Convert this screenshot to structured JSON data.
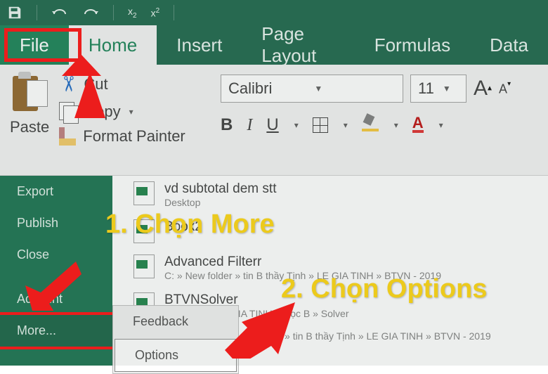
{
  "titlebar": {
    "sub_label": "x",
    "sup_label": "x"
  },
  "tabs": {
    "file": "File",
    "home": "Home",
    "insert": "Insert",
    "page_layout": "Page Layout",
    "formulas": "Formulas",
    "data": "Data"
  },
  "ribbon": {
    "paste": "Paste",
    "cut": "Cut",
    "copy": "Copy",
    "format_painter": "Format Painter",
    "font_name": "Calibri",
    "font_size": "11",
    "bold": "B",
    "italic": "I",
    "underline": "U",
    "font_color_letter": "A"
  },
  "backstage": {
    "export": "Export",
    "publish": "Publish",
    "close": "Close",
    "account": "Account",
    "more": "More..."
  },
  "submenu": {
    "feedback": "Feedback",
    "options": "Options"
  },
  "recent": [
    {
      "name": "vd subtotal dem stt",
      "path": "Desktop"
    },
    {
      "name": "Book2",
      "path": ""
    },
    {
      "name": "Advanced Filterr",
      "path": "C: » New folder » tin B thầy Tịnh » LE GIA TINH » BTVN - 2019"
    },
    {
      "name": "BTVNSolver",
      "path": "thầy Tịnh » LE GIA TINH » Học B » Solver"
    },
    {
      "name": "",
      "path": "older » tin B thầy Tịnh » LE GIA TINH » BTVN - 2019"
    }
  ],
  "annotations": {
    "step1": "1. Chọn More",
    "step2": "2. Chọn Options"
  }
}
